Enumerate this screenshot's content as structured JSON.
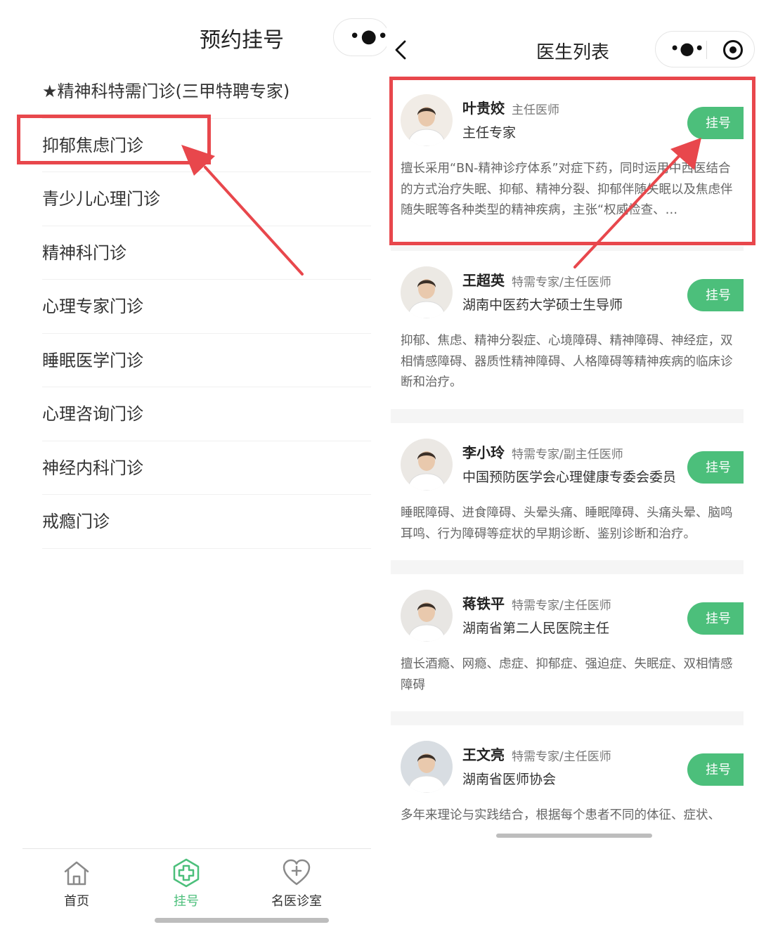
{
  "left": {
    "title": "预约挂号",
    "capsule_dots": "•●•",
    "clinics": [
      "★精神科特需门诊(三甲特聘专家)",
      "抑郁焦虑门诊",
      "青少儿心理门诊",
      "精神科门诊",
      "心理专家门诊",
      "睡眠医学门诊",
      "心理咨询门诊",
      "神经内科门诊",
      "戒瘾门诊"
    ],
    "highlighted_clinic_index": 1,
    "tabbar": {
      "items": [
        {
          "label": "首页",
          "icon": "home-icon",
          "active": false
        },
        {
          "label": "挂号",
          "icon": "plus-circle-icon",
          "active": true
        },
        {
          "label": "名医诊室",
          "icon": "heart-plus-icon",
          "active": false
        }
      ],
      "active_color": "#4cbf7b"
    }
  },
  "right": {
    "title": "医生列表",
    "capsule_dots": "•●•",
    "register_label": "挂号",
    "doctors": [
      {
        "name": "叶贵姣",
        "title": "主任医师",
        "position": "主任专家",
        "description": "擅长采用“BN-精神诊疗体系”对症下药，同时运用中西医结合的方式治疗失眠、抑郁、精神分裂、抑郁伴随失眠以及焦虑伴随失眠等各种类型的精神疾病，主张“权威检查、…"
      },
      {
        "name": "王超英",
        "title": "特需专家/主任医师",
        "position": "湖南中医药大学硕士生导师",
        "description": "抑郁、焦虑、精神分裂症、心境障碍、精神障碍、神经症，双相情感障碍、器质性精神障碍、人格障碍等精神疾病的临床诊断和治疗。"
      },
      {
        "name": "李小玲",
        "title": "特需专家/副主任医师",
        "position": "中国预防医学会心理健康专委会委员",
        "description": "睡眠障碍、进食障碍、头晕头痛、睡眠障碍、头痛头晕、脑鸣耳鸣、行为障碍等症状的早期诊断、鉴别诊断和治疗。"
      },
      {
        "name": "蒋铁平",
        "title": "特需专家/主任医师",
        "position": "湖南省第二人民医院主任",
        "description": "擅长酒瘾、网瘾、虑症、抑郁症、强迫症、失眠症、双相情感障碍"
      },
      {
        "name": "王文亮",
        "title": "特需专家/主任医师",
        "position": "湖南省医师协会",
        "description": "多年来理论与实践结合，根据每个患者不同的体征、症状、"
      }
    ]
  },
  "colors": {
    "accent_green": "#4cbf7b",
    "highlight_red": "#e8474c",
    "separator": "#f0f0f0"
  }
}
